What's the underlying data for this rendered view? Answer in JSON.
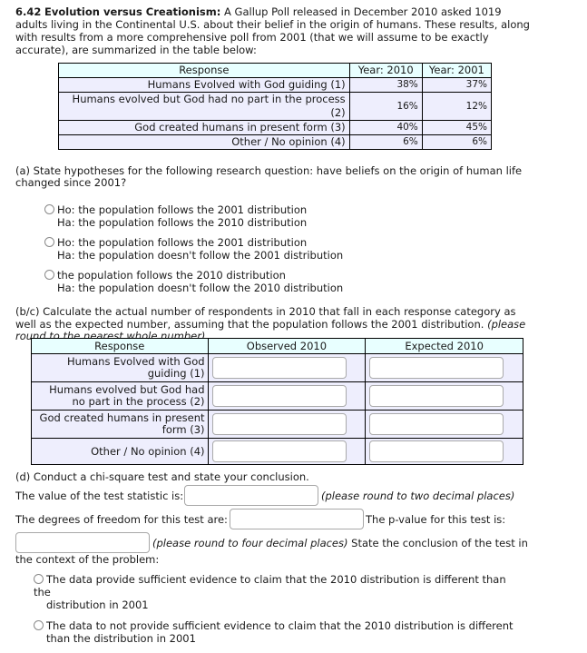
{
  "problem": {
    "number": "6.42",
    "title": "Evolution versus Creationism:",
    "intro": "A Gallup Poll released in December 2010 asked 1019 adults living in the Continental U.S. about their belief in the origin of humans. These results, along with results from a more comprehensive poll from 2001 (that we will assume to be exactly accurate), are summarized in the table below:"
  },
  "poll_table": {
    "headers": [
      "Response",
      "Year: 2010",
      "Year: 2001"
    ],
    "rows": [
      {
        "response": "Humans Evolved with God guiding (1)",
        "y2010": "38%",
        "y2001": "37%"
      },
      {
        "response": "Humans evolved but God had no part in the process (2)",
        "y2010": "16%",
        "y2001": "12%"
      },
      {
        "response": "God created humans in present form (3)",
        "y2010": "40%",
        "y2001": "45%"
      },
      {
        "response": "Other / No opinion (4)",
        "y2010": "6%",
        "y2001": "6%"
      }
    ]
  },
  "part_a": {
    "question": "(a) State hypotheses for the following research question: have beliefs on the origin of human life changed since 2001?",
    "options": [
      {
        "line1": "Ho: the population follows the 2001 distribution",
        "line2": "Ha: the population follows the 2010 distribution",
        "selected": false
      },
      {
        "line1": "Ho: the population follows the 2001 distribution",
        "line2": "Ha: the population doesn't follow the 2001 distribution",
        "selected": false
      },
      {
        "line1": "the population follows the 2010 distribution",
        "line2": "Ha: the population doesn't follow the 2010 distribution",
        "selected": false
      }
    ]
  },
  "part_bc": {
    "question": "(b/c) Calculate the actual number of respondents in 2010 that fall in each response category as well as the expected number, assuming that the population follows the 2001 distribution.",
    "hint": "(please round to the nearest whole number)",
    "headers": [
      "Response",
      "Observed 2010",
      "Expected 2010"
    ],
    "rows": [
      {
        "response": "Humans Evolved with God guiding (1)",
        "observed": "",
        "expected": ""
      },
      {
        "response": "Humans evolved but God had no part in the process (2)",
        "observed": "",
        "expected": ""
      },
      {
        "response": "God created humans in present form (3)",
        "observed": "",
        "expected": ""
      },
      {
        "response": "Other / No opinion (4)",
        "observed": "",
        "expected": ""
      }
    ]
  },
  "part_d": {
    "heading": "(d) Conduct a chi-square test and state your conclusion.",
    "test_statistic_label": "The value of the test statistic is:",
    "test_statistic_value": "",
    "test_statistic_hint": "(please round to two decimal places)",
    "df_label": "The degrees of freedom for this test are:",
    "df_value": "",
    "pvalue_label": "The p-value for this test is:",
    "pvalue_value": "",
    "pvalue_hint": "(please round to four decimal places)",
    "conclusion_label_1": "State the conclusion of the test in",
    "conclusion_label_2": "the context of the problem:",
    "options": [
      {
        "line1": "The data provide sufficient evidence to claim that the 2010 distribution is different than the",
        "line2": "distribution in 2001",
        "selected": false
      },
      {
        "line1": "The data to not provide sufficient evidence to claim that the 2010 distribution is different",
        "line2": "than the distribution in 2001",
        "selected": false
      }
    ]
  }
}
